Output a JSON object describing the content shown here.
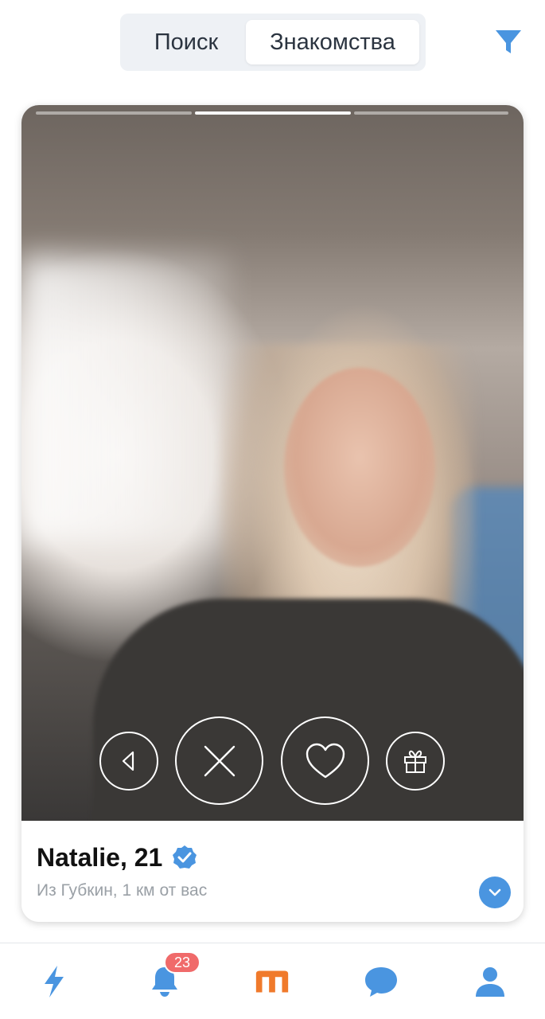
{
  "header": {
    "tabs": [
      {
        "label": "Поиск",
        "selected": false
      },
      {
        "label": "Знакомства",
        "selected": true
      }
    ],
    "filter_icon": "filter-funnel-icon"
  },
  "profile_card": {
    "photo_count": 3,
    "current_photo": 2,
    "name_age": "Natalie, 21",
    "verified": true,
    "location": "Из Губкин, 1 км от вас",
    "actions": [
      "back-icon",
      "dislike-x-icon",
      "like-heart-icon",
      "gift-icon"
    ],
    "expand_icon": "chevron-down-icon"
  },
  "bottom_nav": {
    "items": [
      {
        "icon": "lightning-icon"
      },
      {
        "icon": "bell-icon",
        "badge": "23"
      },
      {
        "icon": "meet-logo-icon",
        "active": true
      },
      {
        "icon": "chat-bubble-icon"
      },
      {
        "icon": "profile-icon"
      }
    ]
  },
  "colors": {
    "accent_blue": "#4a95e0",
    "brand_orange": "#f07a2b",
    "badge_red": "#f06a6a"
  }
}
